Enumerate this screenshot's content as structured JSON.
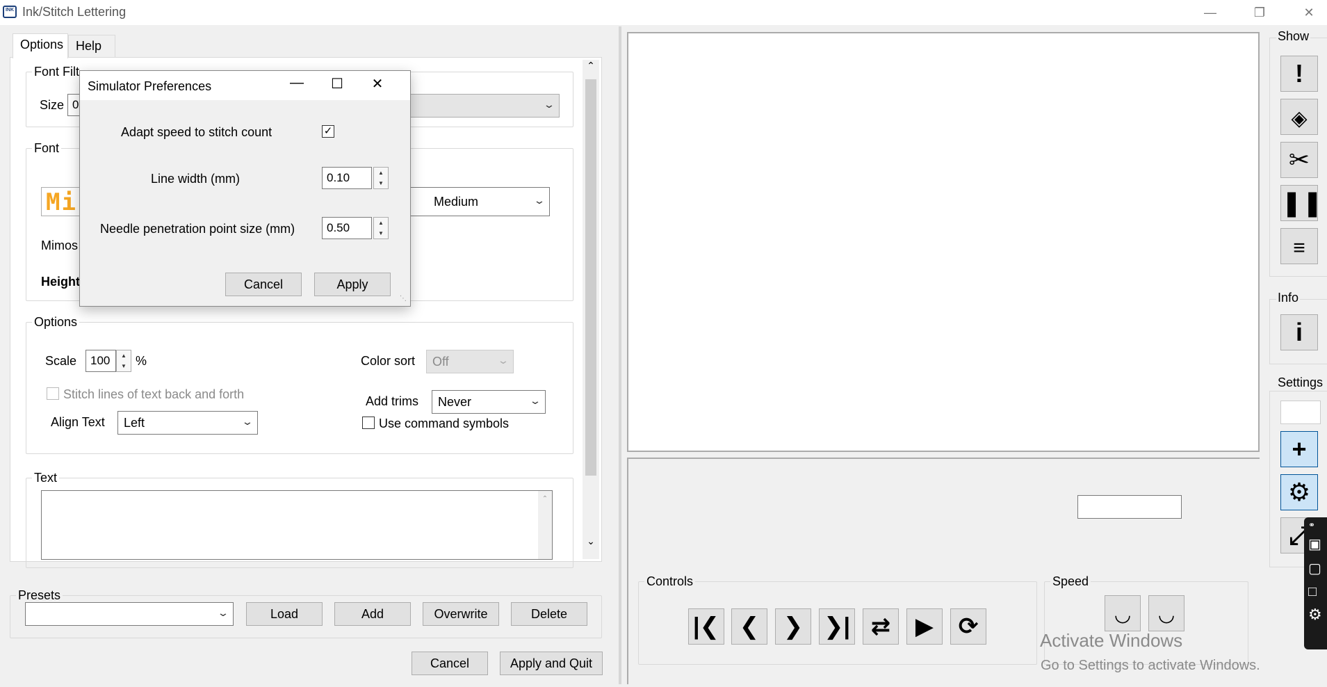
{
  "window": {
    "title": "Ink/Stitch Lettering",
    "icon_text": "INK"
  },
  "tabs": [
    {
      "label": "Options"
    },
    {
      "label": "Help"
    }
  ],
  "font_filter": {
    "legend": "Font Filt",
    "size_label": "Size",
    "size_value": "0",
    "filter_value": "--"
  },
  "font": {
    "legend": "Font",
    "preview_text": "Mi",
    "variant_value": "Medium",
    "name_partial": "Mimos",
    "height_partial": "Height"
  },
  "options": {
    "legend": "Options",
    "scale_label": "Scale",
    "scale_value": "100",
    "scale_unit": "%",
    "stitch_lines_label": "Stitch lines of text back and forth",
    "align_label": "Align Text",
    "align_value": "Left",
    "color_sort_label": "Color sort",
    "color_sort_value": "Off",
    "add_trims_label": "Add trims",
    "add_trims_value": "Never",
    "command_symbols_label": "Use command symbols"
  },
  "text_group": {
    "legend": "Text",
    "value": ""
  },
  "presets": {
    "legend": "Presets",
    "selected": "",
    "load": "Load",
    "add": "Add",
    "overwrite": "Overwrite",
    "delete": "Delete"
  },
  "footer": {
    "cancel": "Cancel",
    "apply_quit": "Apply and Quit"
  },
  "dialog": {
    "title": "Simulator Preferences",
    "adapt_speed_label": "Adapt speed to stitch count",
    "adapt_speed_checked": true,
    "line_width_label": "Line width (mm)",
    "line_width_value": "0.10",
    "needle_label": "Needle penetration point size (mm)",
    "needle_value": "0.50",
    "cancel": "Cancel",
    "apply": "Apply"
  },
  "simulator": {
    "controls_label": "Controls",
    "speed_label": "Speed",
    "stitch_field_value": "",
    "show_label": "Show",
    "info_label": "Info",
    "settings_label": "Settings"
  },
  "watermark": {
    "line1": "Activate Windows",
    "line2": "Go to Settings to activate Windows."
  },
  "colors": {
    "accent_blue": "#cce4f7",
    "accent_border": "#005499",
    "preview_orange": "#f5a623"
  }
}
